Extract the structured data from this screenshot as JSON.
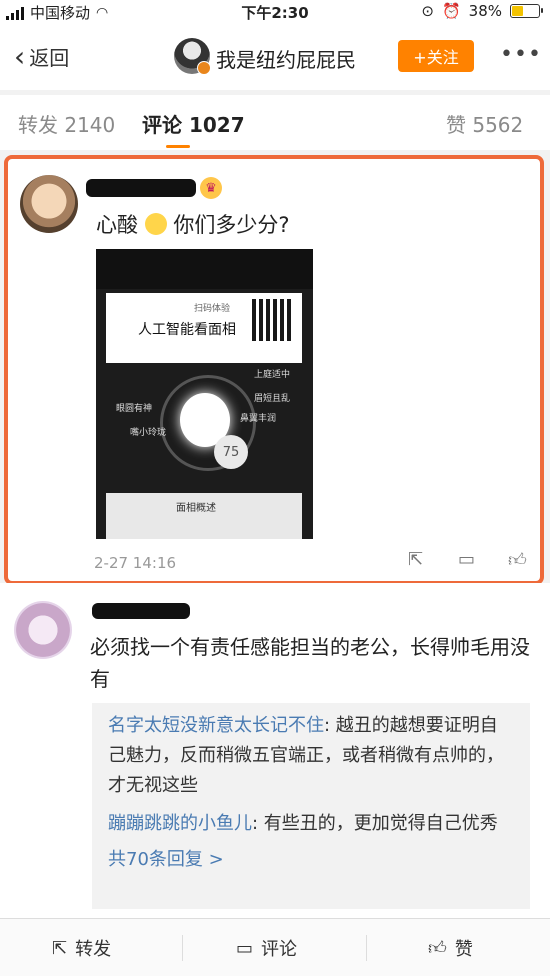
{
  "status_bar": {
    "carrier": "中国移动",
    "time": "下午2:30",
    "battery": "38%",
    "battery_level": 0.38
  },
  "nav": {
    "back_label": "返回",
    "title": "我是纽约屁屁民",
    "follow_label": "+关注",
    "more_label": "•••"
  },
  "tabs": [
    {
      "label": "转发",
      "count": "2140"
    },
    {
      "label": "评论",
      "count": "1027"
    },
    {
      "label": "赞",
      "count": "5562"
    }
  ],
  "comments": [
    {
      "text": "心酸",
      "text_after_emoji": "你们多少分?",
      "image": {
        "scan_label": "扫码体验",
        "title": "人工智能看面相",
        "labels": [
          "上庭适中",
          "眉短且乱",
          "眼圆有神",
          "鼻翼丰润",
          "嘴小玲珑"
        ],
        "score": "75",
        "summary_title": "面相概述"
      },
      "time": "2-27 14:16"
    },
    {
      "text": "必须找一个有责任感能担当的老公，长得帅毛用没有",
      "replies": [
        {
          "user": "名字太短没新意太长记不住",
          "text": ": 越丑的越想要证明自己魅力，反而稍微五官端正，或者稍微有点帅的，才无视这些"
        },
        {
          "user": "蹦蹦跳跳的小鱼儿",
          "text": ": 有些丑的，更加觉得自己优秀"
        }
      ],
      "more_replies": "共70条回复 >"
    }
  ],
  "bottom_bar": {
    "repost": "转发",
    "comment": "评论",
    "like": "赞"
  }
}
